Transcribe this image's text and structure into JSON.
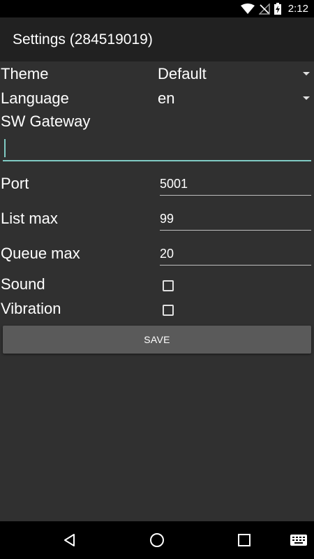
{
  "status_bar": {
    "time": "2:12",
    "icons": [
      "wifi-icon",
      "no-signal-icon",
      "battery-charging-icon"
    ]
  },
  "action_bar": {
    "title": "Settings (284519019)"
  },
  "settings": {
    "theme": {
      "label": "Theme",
      "value": "Default"
    },
    "language": {
      "label": "Language",
      "value": "en"
    },
    "gateway": {
      "label": "SW Gateway",
      "value": ""
    },
    "port": {
      "label": "Port",
      "value": "5001"
    },
    "list_max": {
      "label": "List max",
      "value": "99"
    },
    "queue_max": {
      "label": "Queue max",
      "value": "20"
    },
    "sound": {
      "label": "Sound",
      "checked": false
    },
    "vibration": {
      "label": "Vibration",
      "checked": false
    }
  },
  "save_button": {
    "label": "SAVE"
  },
  "nav_bar": {
    "icons": [
      "back-icon",
      "home-icon",
      "recents-icon",
      "keyboard-icon"
    ]
  },
  "colors": {
    "background": "#303030",
    "action_bar": "#212121",
    "accent": "#80cbc4",
    "button": "#5a5a5a"
  }
}
